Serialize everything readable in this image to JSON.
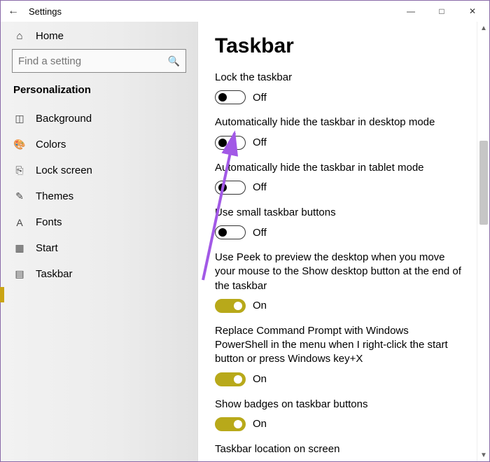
{
  "titlebar": {
    "title": "Settings"
  },
  "sidebar": {
    "home": "Home",
    "search_placeholder": "Find a setting",
    "section": "Personalization",
    "items": [
      {
        "label": "Background"
      },
      {
        "label": "Colors"
      },
      {
        "label": "Lock screen"
      },
      {
        "label": "Themes"
      },
      {
        "label": "Fonts"
      },
      {
        "label": "Start"
      },
      {
        "label": "Taskbar"
      }
    ]
  },
  "main": {
    "title": "Taskbar",
    "settings": [
      {
        "label": "Lock the taskbar",
        "state": "Off",
        "on": false
      },
      {
        "label": "Automatically hide the taskbar in desktop mode",
        "state": "Off",
        "on": false
      },
      {
        "label": "Automatically hide the taskbar in tablet mode",
        "state": "Off",
        "on": false
      },
      {
        "label": "Use small taskbar buttons",
        "state": "Off",
        "on": false
      },
      {
        "label": "Use Peek to preview the desktop when you move your mouse to the Show desktop button at the end of the taskbar",
        "state": "On",
        "on": true
      },
      {
        "label": "Replace Command Prompt with Windows PowerShell in the menu when I right-click the start button or press Windows key+X",
        "state": "On",
        "on": true
      },
      {
        "label": "Show badges on taskbar buttons",
        "state": "On",
        "on": true
      },
      {
        "label": "Taskbar location on screen",
        "state": "",
        "on": null
      }
    ]
  }
}
